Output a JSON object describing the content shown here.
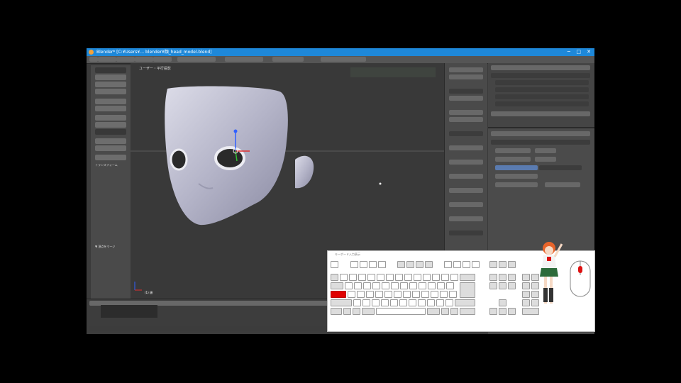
{
  "window": {
    "title": "Blender* [C:¥Users¥… blender¥顔_head_model.blend]",
    "controls": [
      "─",
      "□",
      "✕"
    ]
  },
  "menu": {
    "items": [
      "",
      "",
      "",
      "",
      "",
      "",
      "",
      "",
      "",
      "",
      ""
    ]
  },
  "viewport": {
    "label": "ユーザー・平行投影",
    "object_label": "(1) 顔"
  },
  "tool_shelf": {
    "section_label": "トランスフォーム",
    "bottom_label": "▼ 頂点をマージ"
  },
  "colors": {
    "window_bg": "#3a3a3a",
    "title_bar": "#1e88d9",
    "viewport_bg": "#393939",
    "panel_bg": "#4a4a4a",
    "active_key": "#e00000",
    "selection_blue": "#5a7bb0"
  },
  "keyboard_overlay": {
    "title": "キーボード入力表示",
    "active_key": "Shift",
    "space_label": "",
    "mouse_icon": "mouse-icon",
    "mascot_icon": "anime-girl-mascot"
  }
}
